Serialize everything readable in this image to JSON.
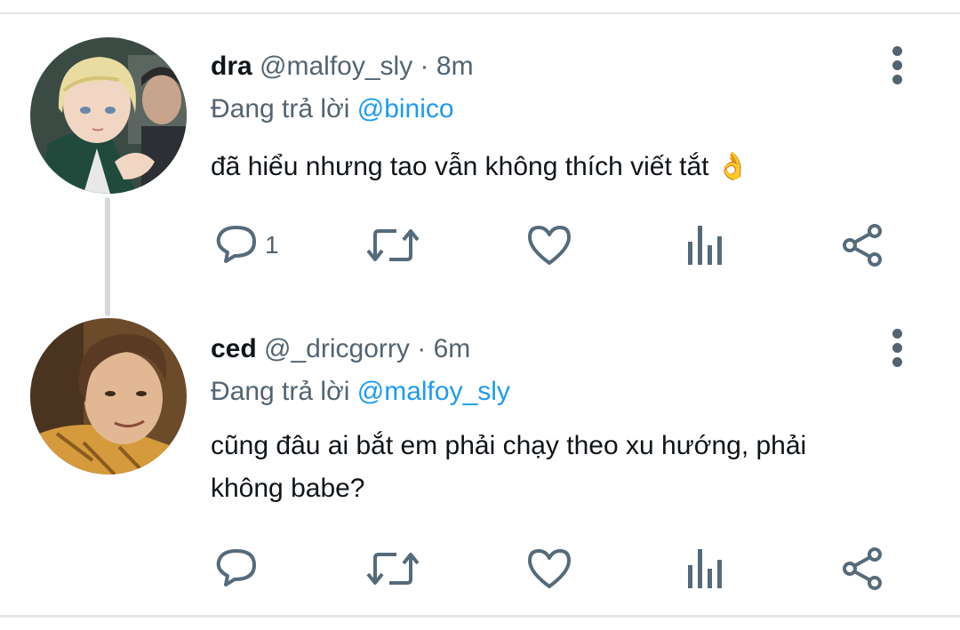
{
  "tweets": [
    {
      "name": "dra",
      "handle": "@malfoy_sly",
      "separator": "·",
      "time": "8m",
      "replying_prefix": "Đang trả lời ",
      "replying_to": "@binico",
      "text": "đã hiểu nhưng tao vẫn không thích viết tắt 👌",
      "reply_count": "1"
    },
    {
      "name": "ced",
      "handle": "@_dricgorry",
      "separator": "·",
      "time": "6m",
      "replying_prefix": "Đang trả lời ",
      "replying_to": "@malfoy_sly",
      "text": "cũng đâu ai bắt em phải chạy theo xu hướng, phải không babe?",
      "reply_count": ""
    }
  ],
  "colors": {
    "accent": "#1d9bf0",
    "secondary_text": "#536471",
    "icon": "#566b7a"
  },
  "icons": [
    "reply-icon",
    "retweet-icon",
    "like-icon",
    "views-icon",
    "share-icon",
    "more-icon"
  ]
}
